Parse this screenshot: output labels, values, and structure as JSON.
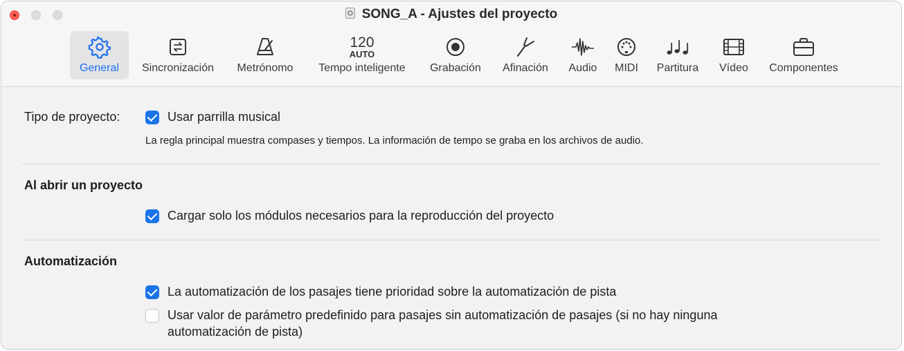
{
  "window": {
    "title": "SONG_A - Ajustes del proyecto"
  },
  "tabs": [
    {
      "id": "general",
      "label": "General",
      "icon": "gear-icon",
      "active": true
    },
    {
      "id": "sync",
      "label": "Sincronización",
      "icon": "sync-icon"
    },
    {
      "id": "metronome",
      "label": "Metrónomo",
      "icon": "metronome-icon"
    },
    {
      "id": "smart-tempo",
      "label": "Tempo inteligente",
      "icon_text": "120",
      "icon_subtext": "AUTO"
    },
    {
      "id": "recording",
      "label": "Grabación",
      "icon": "record-icon"
    },
    {
      "id": "tuning",
      "label": "Afinación",
      "icon": "tuning-fork-icon"
    },
    {
      "id": "audio",
      "label": "Audio",
      "icon": "waveform-icon"
    },
    {
      "id": "midi",
      "label": "MIDI",
      "icon": "midi-port-icon"
    },
    {
      "id": "score",
      "label": "Partitura",
      "icon": "notes-icon"
    },
    {
      "id": "video",
      "label": "Vídeo",
      "icon": "film-icon"
    },
    {
      "id": "assets",
      "label": "Componentes",
      "icon": "briefcase-icon"
    }
  ],
  "general": {
    "project_type": {
      "label": "Tipo de proyecto:",
      "checkbox_label": "Usar parrilla musical",
      "checked": true,
      "description": "La regla principal muestra compases y tiempos. La información de tempo se graba en los archivos de audio."
    },
    "on_open": {
      "title": "Al abrir un proyecto",
      "checkbox_label": "Cargar solo los módulos necesarios para la reproducción del proyecto",
      "checked": true
    },
    "automation": {
      "title": "Automatización",
      "option1_label": "La automatización de los pasajes tiene prioridad sobre la automatización de pista",
      "option1_checked": true,
      "option2_line1": "Usar valor de parámetro predefinido para pasajes sin automatización de pasajes (si no hay ninguna",
      "option2_line2": "automatización de pista)",
      "option2_checked": false
    }
  },
  "colors": {
    "accent": "#1a73e8",
    "active_tab_text": "#1d6ff2",
    "close_button": "#ff5f57"
  }
}
